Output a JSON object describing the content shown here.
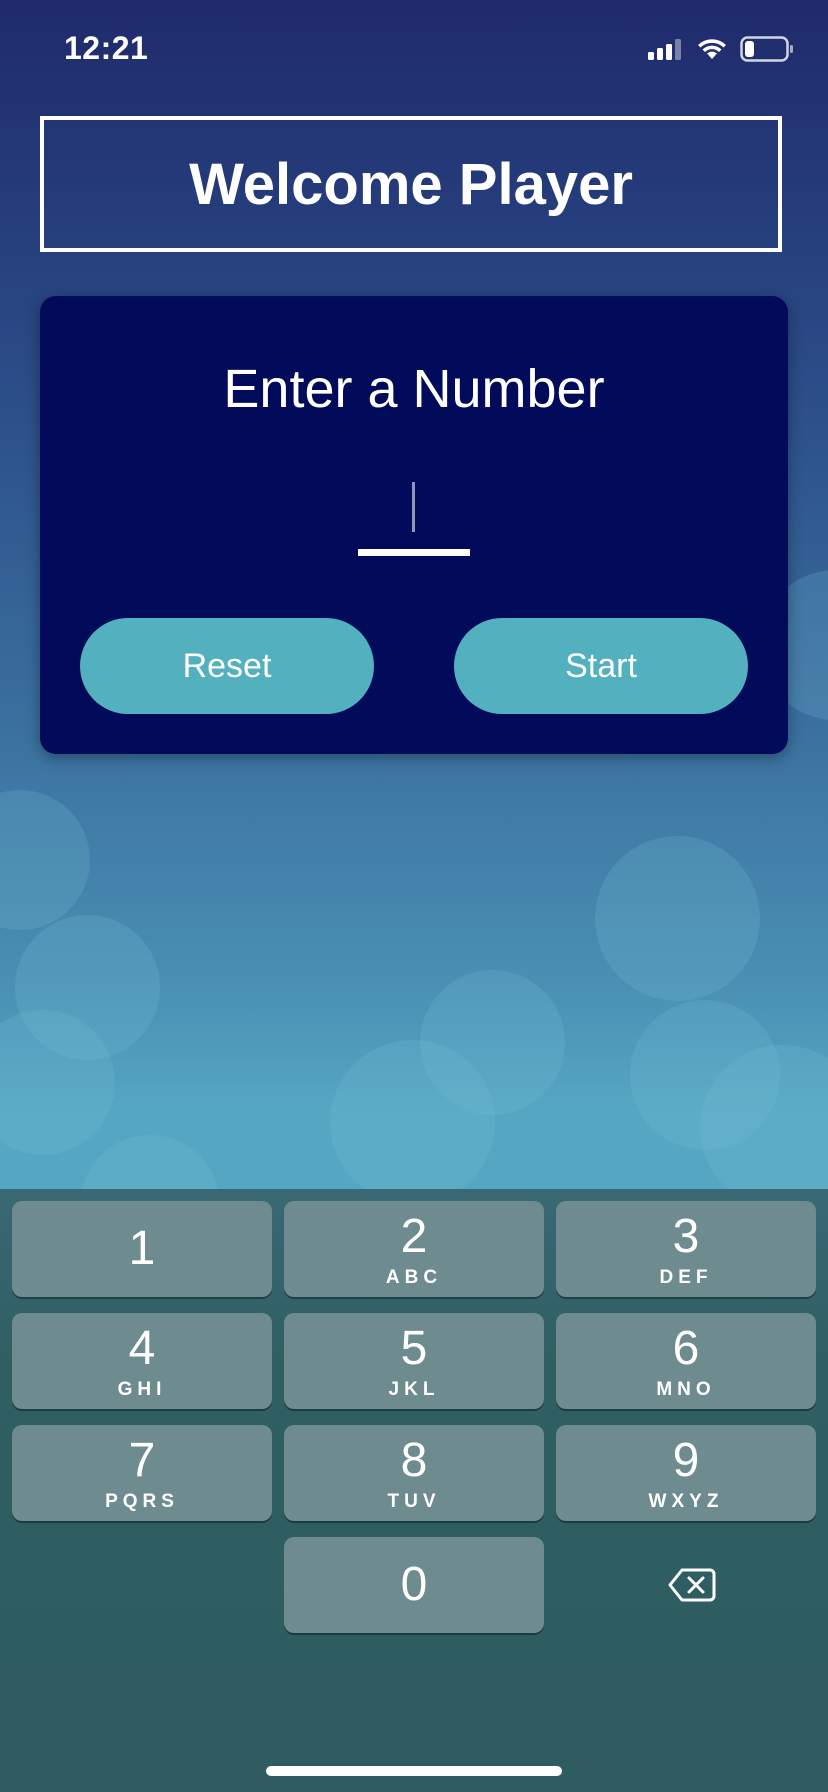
{
  "status_bar": {
    "time": "12:21",
    "icons": [
      "signal-icon",
      "wifi-icon",
      "battery-icon"
    ]
  },
  "header": {
    "title": "Welcome Player"
  },
  "card": {
    "title": "Enter a Number",
    "input": {
      "value": "",
      "placeholder": ""
    },
    "reset_label": "Reset",
    "start_label": "Start"
  },
  "keyboard": {
    "keys": [
      {
        "digit": "1",
        "letters": ""
      },
      {
        "digit": "2",
        "letters": "ABC"
      },
      {
        "digit": "3",
        "letters": "DEF"
      },
      {
        "digit": "4",
        "letters": "GHI"
      },
      {
        "digit": "5",
        "letters": "JKL"
      },
      {
        "digit": "6",
        "letters": "MNO"
      },
      {
        "digit": "7",
        "letters": "PQRS"
      },
      {
        "digit": "8",
        "letters": "TUV"
      },
      {
        "digit": "9",
        "letters": "WXYZ"
      },
      {
        "digit": "0",
        "letters": ""
      }
    ],
    "backspace_icon": "backspace-icon"
  },
  "colors": {
    "card_background": "#020a5a",
    "button": "#52b0bf",
    "key": "#6e8c8f"
  }
}
